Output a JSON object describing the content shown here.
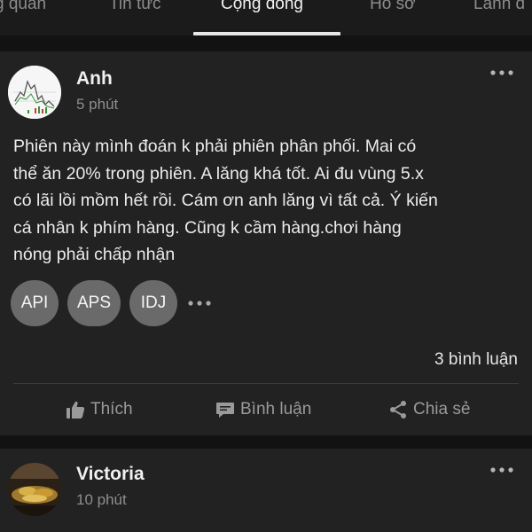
{
  "tabs": [
    {
      "label": "g quan"
    },
    {
      "label": "Tin tức"
    },
    {
      "label": "Cộng đồng",
      "active": true
    },
    {
      "label": "Hồ sơ"
    },
    {
      "label": "Lãnh đ"
    }
  ],
  "posts": [
    {
      "author": "Anh",
      "time": "5 phút",
      "content": "Phiên này mình đoán k phải phiên phân phối. Mai có\nthể ăn 20% trong phiên. A lăng khá tốt. Ai đu vùng 5.x\ncó lãi lồi mồm hết rồi. Cám ơn anh lăng vì tất cả. Ý kiến\ncá nhân k phím hàng. Cũng k cầm hàng.chơi hàng\nnóng phải chấp nhận",
      "tags": [
        "API",
        "APS",
        "IDJ"
      ],
      "comment_count": "3 bình luận",
      "actions": {
        "like": "Thích",
        "comment": "Bình luận",
        "share": "Chia sẻ"
      }
    },
    {
      "author": "Victoria",
      "time": "10 phút"
    }
  ],
  "icons": {
    "more": "more-horizontal-icon",
    "like": "thumbs-up-icon",
    "comment": "comment-icon",
    "share": "share-icon"
  },
  "colors": {
    "background": "#121212",
    "card": "#222222",
    "chip": "#6a6a6a",
    "muted_text": "#8e8e8e"
  }
}
